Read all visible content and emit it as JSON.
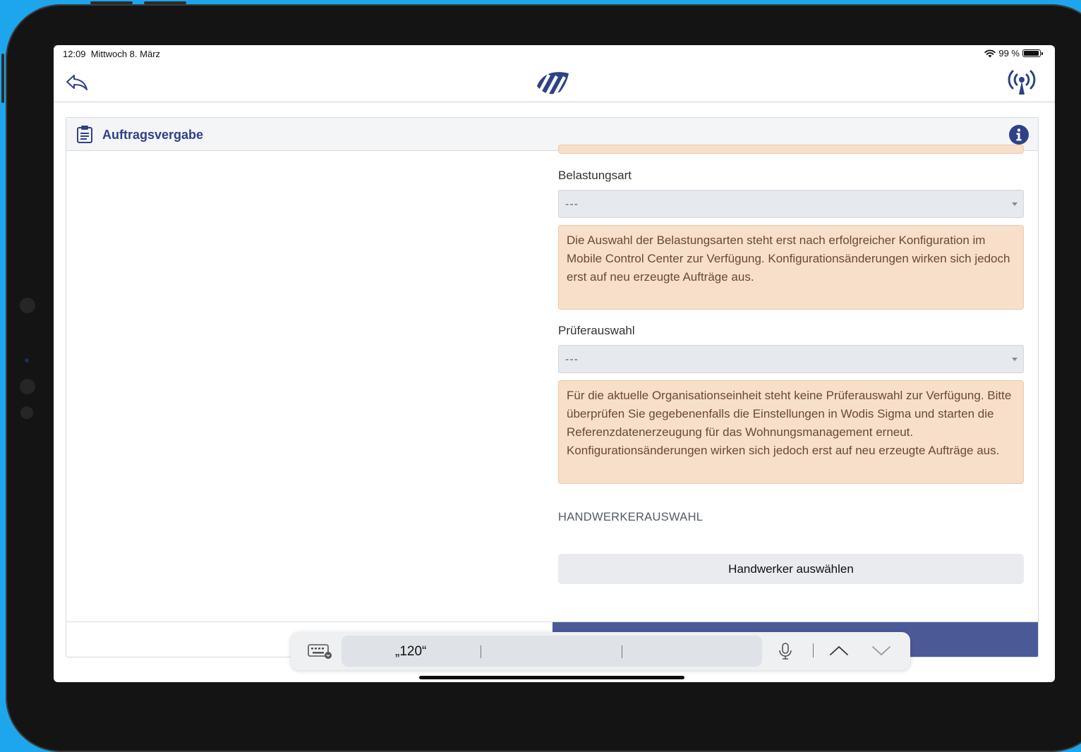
{
  "status_bar": {
    "time": "12:09",
    "date": "Mittwoch 8. März",
    "battery_percent": "99 %"
  },
  "nav": {
    "back_icon": "back-arrow-icon",
    "logo_icon": "app-logo-icon",
    "connection_icon": "radio-tower-icon"
  },
  "card": {
    "title": "Auftragsvergabe",
    "title_icon": "clipboard-icon",
    "info_icon": "info-icon"
  },
  "form": {
    "belastungsart": {
      "label": "Belastungsart",
      "value": "---",
      "notice": "Die Auswahl der Belastungsarten steht erst nach erfolgreicher Konfiguration im Mobile Control Center zur Verfügung. Konfigurationsänderungen wirken sich jedoch erst auf neu erzeugte Aufträge aus."
    },
    "prueferauswahl": {
      "label": "Prüferauswahl",
      "value": "---",
      "notice": "Für die aktuelle Organisationseinheit steht keine Prüferauswahl zur Verfügung. Bitte überprüfen Sie gegebenenfalls die Einstellungen in Wodis Sigma und starten die Referenzdatenerzeugung für das Wohnungsmanagement erneut. Konfigurationsänderungen wirken sich jedoch erst auf neu erzeugte Aufträge aus."
    },
    "handwerker_section": "HANDWERKERAUSWAHL",
    "handwerker_button": "Handwerker auswählen"
  },
  "keyboard_bar": {
    "suggestion": "„120“",
    "keyboard_icon": "keyboard-icon",
    "mic_icon": "microphone-icon",
    "up_icon": "chevron-up-icon",
    "down_icon": "chevron-down-icon"
  },
  "colors": {
    "brand": "#2f4286",
    "footer_button": "#4b5a97",
    "notice_bg": "#f8dfc9",
    "frame_bg": "#1ea6ec"
  }
}
